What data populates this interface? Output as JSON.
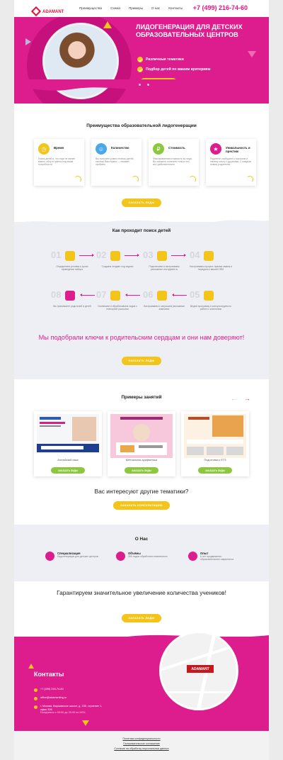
{
  "header": {
    "logo_text": "ADAMANT",
    "logo_sub": "MEDIA GROUP",
    "nav": [
      "Преимущества",
      "Схема",
      "Примеры",
      "О нас",
      "Контакты"
    ],
    "phone": "+7 (499) 216-74-60"
  },
  "hero": {
    "title": "ЛИДОГЕНЕРАЦИЯ ДЛЯ ДЕТСКИХ ОБРАЗОВАТЕЛЬНЫХ ЦЕНТРОВ",
    "points": [
      "Различные тематики",
      "Подбор детей по вашим критериям"
    ],
    "button": "Заказать лиды"
  },
  "advantages": {
    "title": "Преимущества образовательной лидогенерации",
    "cards": [
      {
        "title": "Время",
        "text": "Поиск детей и, что еще не менее важно, сбор в группы под ваши потребности",
        "icon": "clock-icon",
        "color": "#f3c51b"
      },
      {
        "title": "Количество",
        "text": "Вы получите ровно столько детей, сколько Вам нужно — никаких проблем",
        "icon": "people-icon",
        "color": "#4aa8e8"
      },
      {
        "title": "Стоимость",
        "text": "Фиксированная стоимость за лида. Вы сможете оплатить только тех, кого действительно",
        "icon": "price-icon",
        "color": "#8dc63f"
      },
      {
        "title": "Уникальность и престиж",
        "text": "Родители сообщают о хорошем и своему опыту с друзьями. С каждым новым родителем",
        "icon": "star-icon",
        "color": "#dd1d8e"
      }
    ],
    "button": "Заказать лиды"
  },
  "process": {
    "title": "Как проходит поиск детей",
    "steps": [
      {
        "num": "01",
        "text": "Определяем условия и сроки проведения набора"
      },
      {
        "num": "02",
        "text": "Создаем лендинг под задачи"
      },
      {
        "num": "03",
        "text": "Подключаем и настраиваем рекламные инструменты"
      },
      {
        "num": "04",
        "text": "Настраиваем процесс приема заявок и передачи к вашей CRM"
      },
      {
        "num": "05",
        "text": "Ведем программу и консультируем по работе с клиентами"
      },
      {
        "num": "06",
        "text": "Настраиваем и запускаем рекламные кампании"
      },
      {
        "num": "07",
        "text": "Усиливаем и обрабатываем лидов с повторной рассылки"
      },
      {
        "num": "08",
        "text": "Вы принимаете родителей и детей"
      }
    ],
    "slogan": "Мы подобрали ключи к родительским сердцам и они нам доверяют!",
    "button": "Заказать лиды"
  },
  "examples": {
    "title": "Примеры занятий",
    "prev": "←",
    "next": "→",
    "items": [
      {
        "caption": "Английский язык",
        "button": "Заказать лиды"
      },
      {
        "caption": "Ментальная арифметика",
        "button": "Заказать лиды"
      },
      {
        "caption": "Подготовка к ЕГЭ",
        "button": "Заказать лиды"
      }
    ],
    "question": "Вас интересуют другие тематики?",
    "button": "Заказать консультацию"
  },
  "about": {
    "title": "О Нас",
    "items": [
      {
        "title": "Специализация",
        "text": "Лидогенерация для детских центров"
      },
      {
        "title": "Объёмы",
        "text": "300 лидов обработано ежемесячно"
      },
      {
        "title": "Опыт",
        "text": "6 лет продвижения образовательного маркетинга"
      }
    ],
    "guarantee": "Гарантируем значительное увеличение количества учеников!",
    "button": "Заказать лиды"
  },
  "contacts": {
    "title": "Контакты",
    "phone": "+7 (499) 216-74-60",
    "email": "office@adamanting.ru",
    "address": "г. Москва, Варшавское шоссе, д. 135, строение 1, офис 326",
    "hours": "Ежедневно с 09:00 до 20:00 по МСК",
    "map_logo": "ADAMANT"
  },
  "footer": {
    "links": [
      "Политика конфиденциальности",
      "Пользовательское соглашение",
      "Согласие на обработку персональных данных"
    ]
  }
}
